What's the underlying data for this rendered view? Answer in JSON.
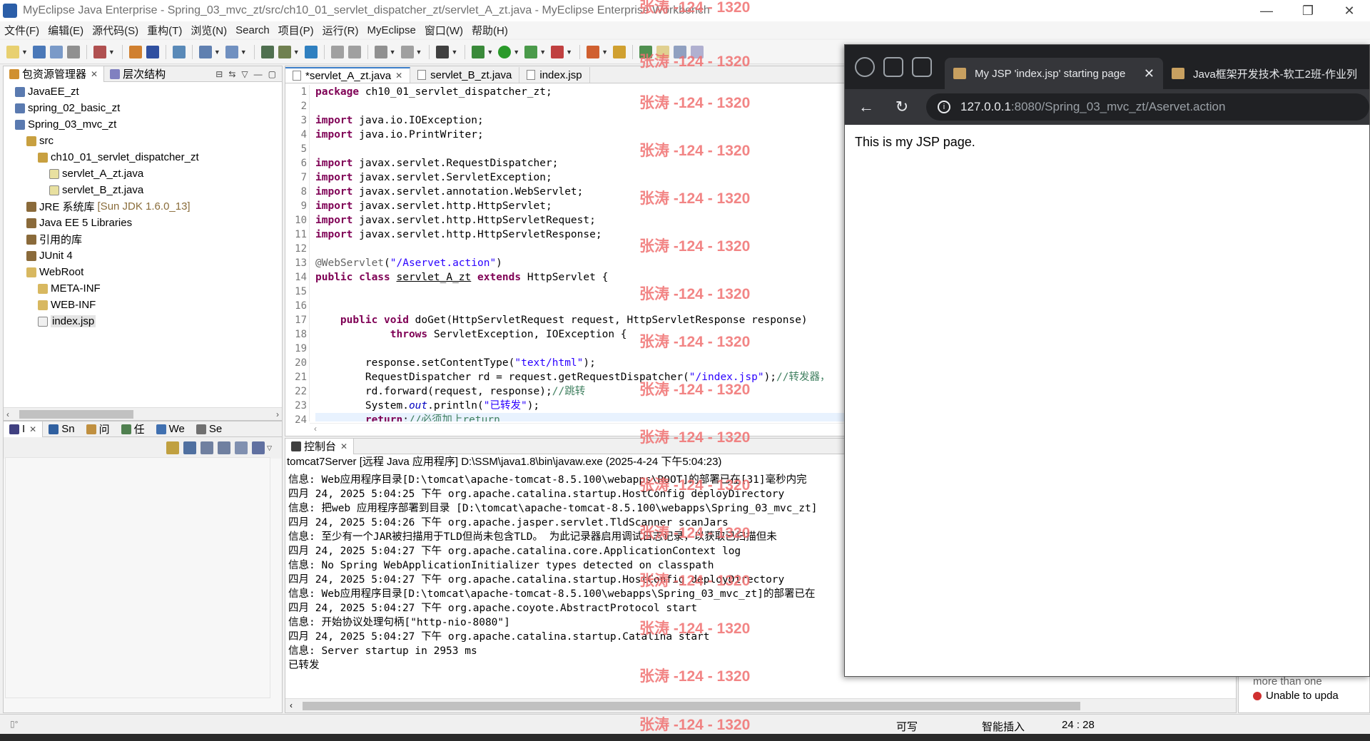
{
  "window": {
    "title": "MyEclipse Java Enterprise  -  Spring_03_mvc_zt/src/ch10_01_servlet_dispatcher_zt/servlet_A_zt.java  -  MyEclipse Enterprise Workbench",
    "minimize": "—",
    "restore": "❐",
    "close": "✕"
  },
  "menu": [
    "文件(F)",
    "编辑(E)",
    "源代码(S)",
    "重构(T)",
    "浏览(N)",
    "Search",
    "项目(P)",
    "运行(R)",
    "MyEclipse",
    "窗口(W)",
    "帮助(H)"
  ],
  "package_explorer": {
    "tab_label": "包资源管理器",
    "tab2_label": "层次结构",
    "tree": [
      {
        "label": "JavaEE_zt",
        "indent": 1,
        "icon": "project"
      },
      {
        "label": "spring_02_basic_zt",
        "indent": 1,
        "icon": "project"
      },
      {
        "label": "Spring_03_mvc_zt",
        "indent": 1,
        "icon": "project"
      },
      {
        "label": "src",
        "indent": 2,
        "icon": "src-folder"
      },
      {
        "label": "ch10_01_servlet_dispatcher_zt",
        "indent": 3,
        "icon": "package"
      },
      {
        "label": "servlet_A_zt.java",
        "indent": 4,
        "icon": "java-file"
      },
      {
        "label": "servlet_B_zt.java",
        "indent": 4,
        "icon": "java-file"
      },
      {
        "label": "JRE 系统库",
        "suffix": "[Sun JDK 1.6.0_13]",
        "indent": 2,
        "icon": "library"
      },
      {
        "label": "Java EE 5 Libraries",
        "indent": 2,
        "icon": "library"
      },
      {
        "label": "引用的库",
        "indent": 2,
        "icon": "library"
      },
      {
        "label": "JUnit 4",
        "indent": 2,
        "icon": "library"
      },
      {
        "label": "WebRoot",
        "indent": 2,
        "icon": "folder"
      },
      {
        "label": "META-INF",
        "indent": 3,
        "icon": "folder"
      },
      {
        "label": "WEB-INF",
        "indent": 3,
        "icon": "folder"
      },
      {
        "label": "index.jsp",
        "indent": 3,
        "icon": "jsp-file",
        "selected": true
      }
    ]
  },
  "lower_left_tabs": [
    "I",
    "Sn",
    "问",
    "任",
    "We",
    "Se"
  ],
  "editor": {
    "tabs": [
      {
        "label": "*servlet_A_zt.java",
        "active": true,
        "closable": true
      },
      {
        "label": "servlet_B_zt.java",
        "active": false
      },
      {
        "label": "index.jsp",
        "active": false
      }
    ],
    "line_numbers": [
      "1",
      "2",
      "3",
      "4",
      "5",
      "6",
      "7",
      "8",
      "9",
      "10",
      "11",
      "12",
      "13",
      "14",
      "15",
      "16",
      "17",
      "18",
      "19",
      "20",
      "21",
      "22",
      "23",
      "24"
    ],
    "current_line": 24
  },
  "console": {
    "tab_label": "控制台",
    "title": "tomcat7Server [远程 Java 应用程序] D:\\SSM\\java1.8\\bin\\javaw.exe  (2025-4-24 下午5:04:23)",
    "lines": [
      "信息: Web应用程序目录[D:\\tomcat\\apache-tomcat-8.5.100\\webapps\\ROOT]的部署已在[31]毫秒内完",
      "四月 24, 2025 5:04:25 下午 org.apache.catalina.startup.HostConfig deployDirectory",
      "信息: 把web 应用程序部署到目录 [D:\\tomcat\\apache-tomcat-8.5.100\\webapps\\Spring_03_mvc_zt]",
      "四月 24, 2025 5:04:26 下午 org.apache.jasper.servlet.TldScanner scanJars",
      "信息: 至少有一个JAR被扫描用于TLD但尚未包含TLD。 为此记录器启用调试日志记录，以获取已扫描但未",
      "四月 24, 2025 5:04:27 下午 org.apache.catalina.core.ApplicationContext log",
      "信息: No Spring WebApplicationInitializer types detected on classpath",
      "四月 24, 2025 5:04:27 下午 org.apache.catalina.startup.HostConfig deployDirectory",
      "信息: Web应用程序目录[D:\\tomcat\\apache-tomcat-8.5.100\\webapps\\Spring_03_mvc_zt]的部署已在",
      "四月 24, 2025 5:04:27 下午 org.apache.coyote.AbstractProtocol start",
      "信息: 开始协议处理句柄[\"http-nio-8080\"]",
      "四月 24, 2025 5:04:27 下午 org.apache.catalina.startup.Catalina start",
      "信息: Server startup in 2953 ms",
      "已转发"
    ]
  },
  "right_panel": {
    "line1": "more than one",
    "line2": "Unable to upda"
  },
  "status_bar": {
    "writable": "可写",
    "insert_mode": "智能插入",
    "position": "24 : 28"
  },
  "browser": {
    "active_tab_title": "My JSP 'index.jsp' starting page",
    "other_tab_title": "Java框架开发技术-软工2班-作业列",
    "url_host": "127.0.0.1",
    "url_path": ":8080/Spring_03_mvc_zt/Aservet.action",
    "page_text": "This is my JSP page."
  },
  "watermark": "张涛 -124 - 1320",
  "colors": {
    "keyword": "#7f0055",
    "string": "#2a00ff",
    "comment": "#3f7f5f",
    "watermark": "#f07070",
    "browser_dark": "#202124"
  }
}
